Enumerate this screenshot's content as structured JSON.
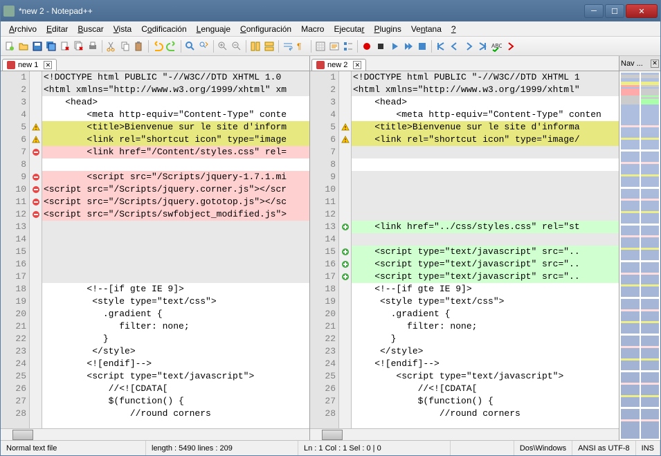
{
  "window": {
    "title": "*new  2 - Notepad++"
  },
  "menu": {
    "archivo": "Archivo",
    "editar": "Editar",
    "buscar": "Buscar",
    "vista": "Vista",
    "codificacion": "Codificación",
    "lenguaje": "Lenguaje",
    "configuracion": "Configuración",
    "macro": "Macro",
    "ejecutar": "Ejecutar",
    "plugins": "Plugins",
    "ventana": "Ventana",
    "ayuda": "?"
  },
  "tabs": {
    "left": "new  1",
    "right": "new  2"
  },
  "navpane": {
    "title": "Nav ..."
  },
  "status": {
    "filetype": "Normal text file",
    "length": "length : 5490    lines : 209",
    "pos": "Ln : 1    Col : 1    Sel : 0 | 0",
    "eol": "Dos\\Windows",
    "encoding": "ANSI as UTF-8",
    "ins": "INS"
  },
  "left_lines": [
    {
      "n": 1,
      "mark": "",
      "cls": "moved",
      "text": "<!DOCTYPE html PUBLIC \"-//W3C//DTD XHTML 1.0"
    },
    {
      "n": 2,
      "mark": "",
      "cls": "moved",
      "text": "<html xmlns=\"http://www.w3.org/1999/xhtml\" xm"
    },
    {
      "n": 3,
      "mark": "",
      "cls": "",
      "text": "    <head>"
    },
    {
      "n": 4,
      "mark": "",
      "cls": "",
      "text": "        <meta http-equiv=\"Content-Type\" conte"
    },
    {
      "n": 5,
      "mark": "warn",
      "cls": "changed",
      "text": "        <title>Bienvenue sur le site d'inform"
    },
    {
      "n": 6,
      "mark": "warn",
      "cls": "changed",
      "text": "        <link rel=\"shortcut icon\" type=\"image"
    },
    {
      "n": 7,
      "mark": "del",
      "cls": "removed",
      "text": "        <link href=\"/Content/styles.css\" rel="
    },
    {
      "n": 8,
      "mark": "",
      "cls": "",
      "text": ""
    },
    {
      "n": 9,
      "mark": "del",
      "cls": "removed",
      "text": "        <script src=\"/Scripts/jquery-1.7.1.mi"
    },
    {
      "n": 10,
      "mark": "del",
      "cls": "removed",
      "text": "<script src=\"/Scripts/jquery.corner.js\"></scr"
    },
    {
      "n": 11,
      "mark": "del",
      "cls": "removed",
      "text": "<script src=\"/Scripts/jquery.gototop.js\"></sc"
    },
    {
      "n": 12,
      "mark": "del",
      "cls": "removed",
      "text": "<script src=\"/Scripts/swfobject_modified.js\">"
    },
    {
      "n": 13,
      "mark": "",
      "cls": "moved",
      "text": ""
    },
    {
      "n": 14,
      "mark": "",
      "cls": "moved",
      "text": ""
    },
    {
      "n": 15,
      "mark": "",
      "cls": "moved",
      "text": ""
    },
    {
      "n": 16,
      "mark": "",
      "cls": "moved",
      "text": ""
    },
    {
      "n": 17,
      "mark": "",
      "cls": "moved",
      "text": ""
    },
    {
      "n": 18,
      "mark": "",
      "cls": "",
      "text": "        <!--[if gte IE 9]>"
    },
    {
      "n": 19,
      "mark": "",
      "cls": "",
      "text": "         <style type=\"text/css\">"
    },
    {
      "n": 20,
      "mark": "",
      "cls": "",
      "text": "           .gradient {"
    },
    {
      "n": 21,
      "mark": "",
      "cls": "",
      "text": "              filter: none;"
    },
    {
      "n": 22,
      "mark": "",
      "cls": "",
      "text": "           }"
    },
    {
      "n": 23,
      "mark": "",
      "cls": "",
      "text": "         </style>"
    },
    {
      "n": 24,
      "mark": "",
      "cls": "",
      "text": "        <![endif]-->"
    },
    {
      "n": 25,
      "mark": "",
      "cls": "",
      "text": "        <script type=\"text/javascript\">"
    },
    {
      "n": 26,
      "mark": "",
      "cls": "",
      "text": "            //<![CDATA["
    },
    {
      "n": 27,
      "mark": "",
      "cls": "",
      "text": "            $(function() {"
    },
    {
      "n": 28,
      "mark": "",
      "cls": "",
      "text": "                //round corners"
    }
  ],
  "right_lines": [
    {
      "n": 1,
      "mark": "",
      "cls": "moved",
      "text": "<!DOCTYPE html PUBLIC \"-//W3C//DTD XHTML 1"
    },
    {
      "n": 2,
      "mark": "",
      "cls": "moved",
      "text": "<html xmlns=\"http://www.w3.org/1999/xhtml\""
    },
    {
      "n": 3,
      "mark": "",
      "cls": "",
      "text": "    <head>"
    },
    {
      "n": 4,
      "mark": "",
      "cls": "",
      "text": "        <meta http-equiv=\"Content-Type\" conten"
    },
    {
      "n": 5,
      "mark": "warn",
      "cls": "changed",
      "text": "    <title>Bienvenue sur le site d'informa"
    },
    {
      "n": 6,
      "mark": "warn",
      "cls": "changed",
      "text": "    <link rel=\"shortcut icon\" type=\"image/"
    },
    {
      "n": 7,
      "mark": "",
      "cls": "moved",
      "text": ""
    },
    {
      "n": 8,
      "mark": "",
      "cls": "",
      "text": ""
    },
    {
      "n": 9,
      "mark": "",
      "cls": "moved",
      "text": ""
    },
    {
      "n": 10,
      "mark": "",
      "cls": "moved",
      "text": ""
    },
    {
      "n": 11,
      "mark": "",
      "cls": "moved",
      "text": ""
    },
    {
      "n": 12,
      "mark": "",
      "cls": "moved",
      "text": ""
    },
    {
      "n": 13,
      "mark": "add",
      "cls": "added",
      "text": "    <link href=\"../css/styles.css\" rel=\"st"
    },
    {
      "n": 14,
      "mark": "",
      "cls": "moved",
      "text": ""
    },
    {
      "n": 15,
      "mark": "add",
      "cls": "added",
      "text": "    <script type=\"text/javascript\" src=\".."
    },
    {
      "n": 16,
      "mark": "add",
      "cls": "added",
      "text": "    <script type=\"text/javascript\" src=\".."
    },
    {
      "n": 17,
      "mark": "add",
      "cls": "added",
      "text": "    <script type=\"text/javascript\" src=\".."
    },
    {
      "n": 18,
      "mark": "",
      "cls": "",
      "text": "    <!--[if gte IE 9]>"
    },
    {
      "n": 19,
      "mark": "",
      "cls": "",
      "text": "     <style type=\"text/css\">"
    },
    {
      "n": 20,
      "mark": "",
      "cls": "",
      "text": "       .gradient {"
    },
    {
      "n": 21,
      "mark": "",
      "cls": "",
      "text": "          filter: none;"
    },
    {
      "n": 22,
      "mark": "",
      "cls": "",
      "text": "       }"
    },
    {
      "n": 23,
      "mark": "",
      "cls": "",
      "text": "     </style>"
    },
    {
      "n": 24,
      "mark": "",
      "cls": "",
      "text": "    <![endif]-->"
    },
    {
      "n": 25,
      "mark": "",
      "cls": "",
      "text": "        <script type=\"text/javascript\">"
    },
    {
      "n": 26,
      "mark": "",
      "cls": "",
      "text": "            //<![CDATA["
    },
    {
      "n": 27,
      "mark": "",
      "cls": "",
      "text": "            $(function() {"
    },
    {
      "n": 28,
      "mark": "",
      "cls": "",
      "text": "                //round corners"
    }
  ]
}
